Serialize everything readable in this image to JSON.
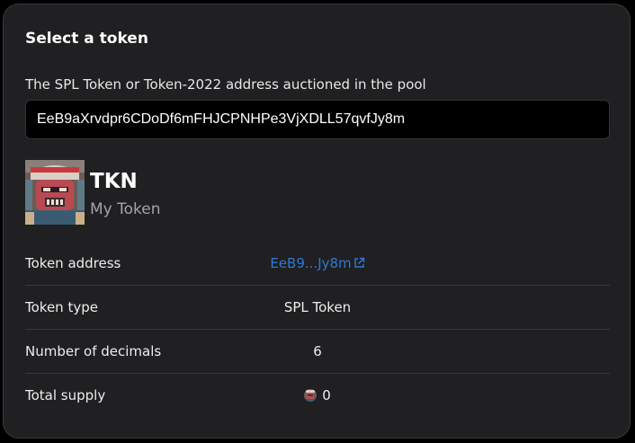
{
  "panel": {
    "title": "Select a token",
    "address_label": "The SPL Token or Token-2022 address auctioned in the pool",
    "address_value": "EeB9aXrvdpr6CDoDf6mFHJCPNHPe3VjXDLL57qvfJy8m"
  },
  "token": {
    "symbol": "TKN",
    "name": "My Token",
    "logo_icon": "token-avatar-robot"
  },
  "details": {
    "rows": [
      {
        "label": "Token address",
        "value": "EeB9...Jy8m",
        "icon": "external-link-icon"
      },
      {
        "label": "Token type",
        "value": "SPL Token"
      },
      {
        "label": "Number of decimals",
        "value": "6"
      },
      {
        "label": "Total supply",
        "value": "0",
        "icon": "token-avatar-robot"
      }
    ]
  },
  "colors": {
    "card_background": "#201f21",
    "card_border": "#3a393b",
    "input_background": "#000000",
    "link": "#2f79d8",
    "muted_text": "#a4a3a6",
    "divider": "#38373a"
  }
}
